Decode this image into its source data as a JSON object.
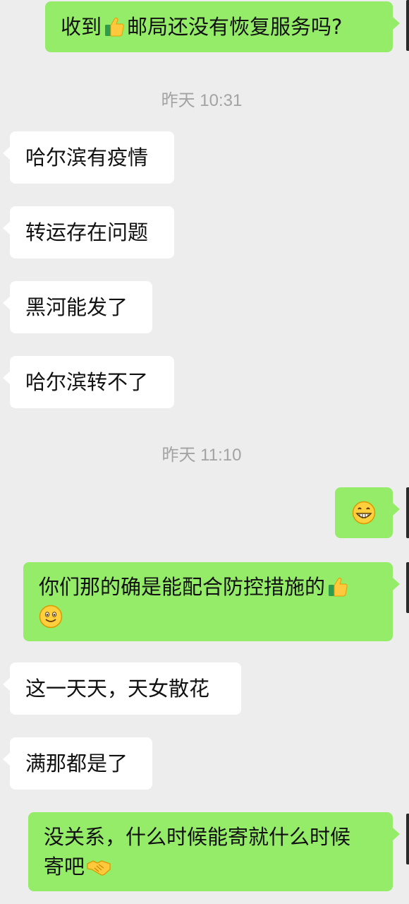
{
  "chat": {
    "messages": [
      {
        "side": "sent",
        "parts": [
          "收到",
          "👍",
          "邮局还没有恢复服务吗?"
        ]
      },
      {
        "side": "recv",
        "text": "哈尔滨有疫情"
      },
      {
        "side": "recv",
        "text": "转运存在问题"
      },
      {
        "side": "recv",
        "text": "黑河能发了"
      },
      {
        "side": "recv",
        "text": "哈尔滨转不了"
      },
      {
        "side": "sent",
        "parts": [
          "😁"
        ]
      },
      {
        "side": "sent",
        "parts": [
          "你们那的确是能配合防控措施的",
          "👍",
          "🙂"
        ]
      },
      {
        "side": "recv",
        "text": "这一天天，天女散花"
      },
      {
        "side": "recv",
        "text": "满那都是了"
      },
      {
        "side": "sent",
        "parts": [
          "没关系，什么时候能寄就什么时候",
          "寄吧",
          "🤝"
        ]
      }
    ],
    "timestamps": [
      "昨天 10:31",
      "昨天 11:10"
    ]
  },
  "icons": {
    "thumbs_up": "thumbs-up-icon",
    "grin": "grinning-face-icon",
    "smile": "smiling-face-icon",
    "handshake": "handshake-icon"
  },
  "colors": {
    "background": "#ededed",
    "sent_bubble": "#95ec69",
    "received_bubble": "#ffffff",
    "timestamp_text": "#a3a3a3"
  }
}
